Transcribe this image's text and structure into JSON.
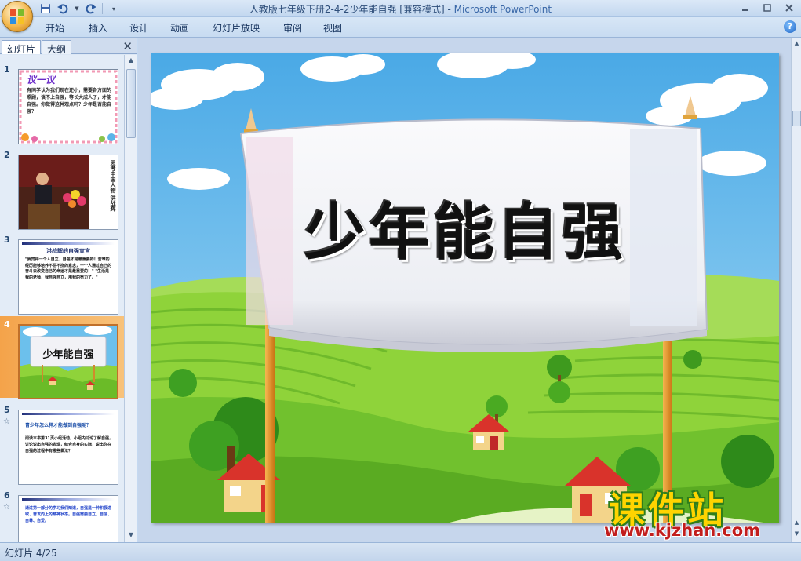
{
  "window": {
    "title": "人教版七年级下册2-4-2少年能自强 [兼容模式]",
    "app_name": "Microsoft PowerPoint",
    "title_separator": " - "
  },
  "ribbon_tabs": [
    "开始",
    "插入",
    "设计",
    "动画",
    "幻灯片放映",
    "审阅",
    "视图"
  ],
  "panel": {
    "tabs": [
      "幻灯片",
      "大纲"
    ],
    "active_tab": "幻灯片"
  },
  "thumbnails": [
    {
      "number": "1",
      "heading": "议一议",
      "text": "有同学认为我们现在还小，需要各方面的照顾，谈不上自强，等长大成人了，才能自强。你觉得这种观点吗？少年是否能自强？",
      "starred": false,
      "selected": false
    },
    {
      "number": "2",
      "heading": "",
      "text": "思考中国人物 洪战辉",
      "starred": false,
      "selected": false
    },
    {
      "number": "3",
      "heading": "洪战辉的自强宣言",
      "text": "\"我觉得一个人自立、自强才是最重要的！苦难的经历能够培养不屈不挠的意志，一个人通过自己的奋斗去改变自己的命运才是最重要的！\" \"生活是我的老师，我自强自立，用我的努力了。\"",
      "starred": false,
      "selected": false
    },
    {
      "number": "4",
      "heading": "少年能自强",
      "text": "",
      "starred": false,
      "selected": true
    },
    {
      "number": "5",
      "heading": "青少年怎么样才能做到自强呢？",
      "text": "阅读本书第31页小组活动，小组内讨论了解自强，讨论说出自强的表现，结合自身的实际，说出你在自强的过程中有哪些做法？",
      "starred": true,
      "selected": false
    },
    {
      "number": "6",
      "heading": "",
      "text": "通过第一部分的学习我们知道，自强是一种积极进取、奋发向上的精神状态。自强需要自立、自信、自尊、自爱。",
      "starred": true,
      "selected": false
    }
  ],
  "slide": {
    "title": "少年能自强"
  },
  "status": {
    "slide_indicator": "幻灯片 4/25"
  },
  "watermark": {
    "title": "课件站",
    "url": "www.kjzhan.com"
  },
  "colors": {
    "sky": "#5eb7ea",
    "grass": "#8fd33a",
    "title_text": "#111111",
    "selected_thumb": "#f4a34a",
    "watermark_yellow": "#ffd400",
    "watermark_red": "#c21d1d"
  }
}
